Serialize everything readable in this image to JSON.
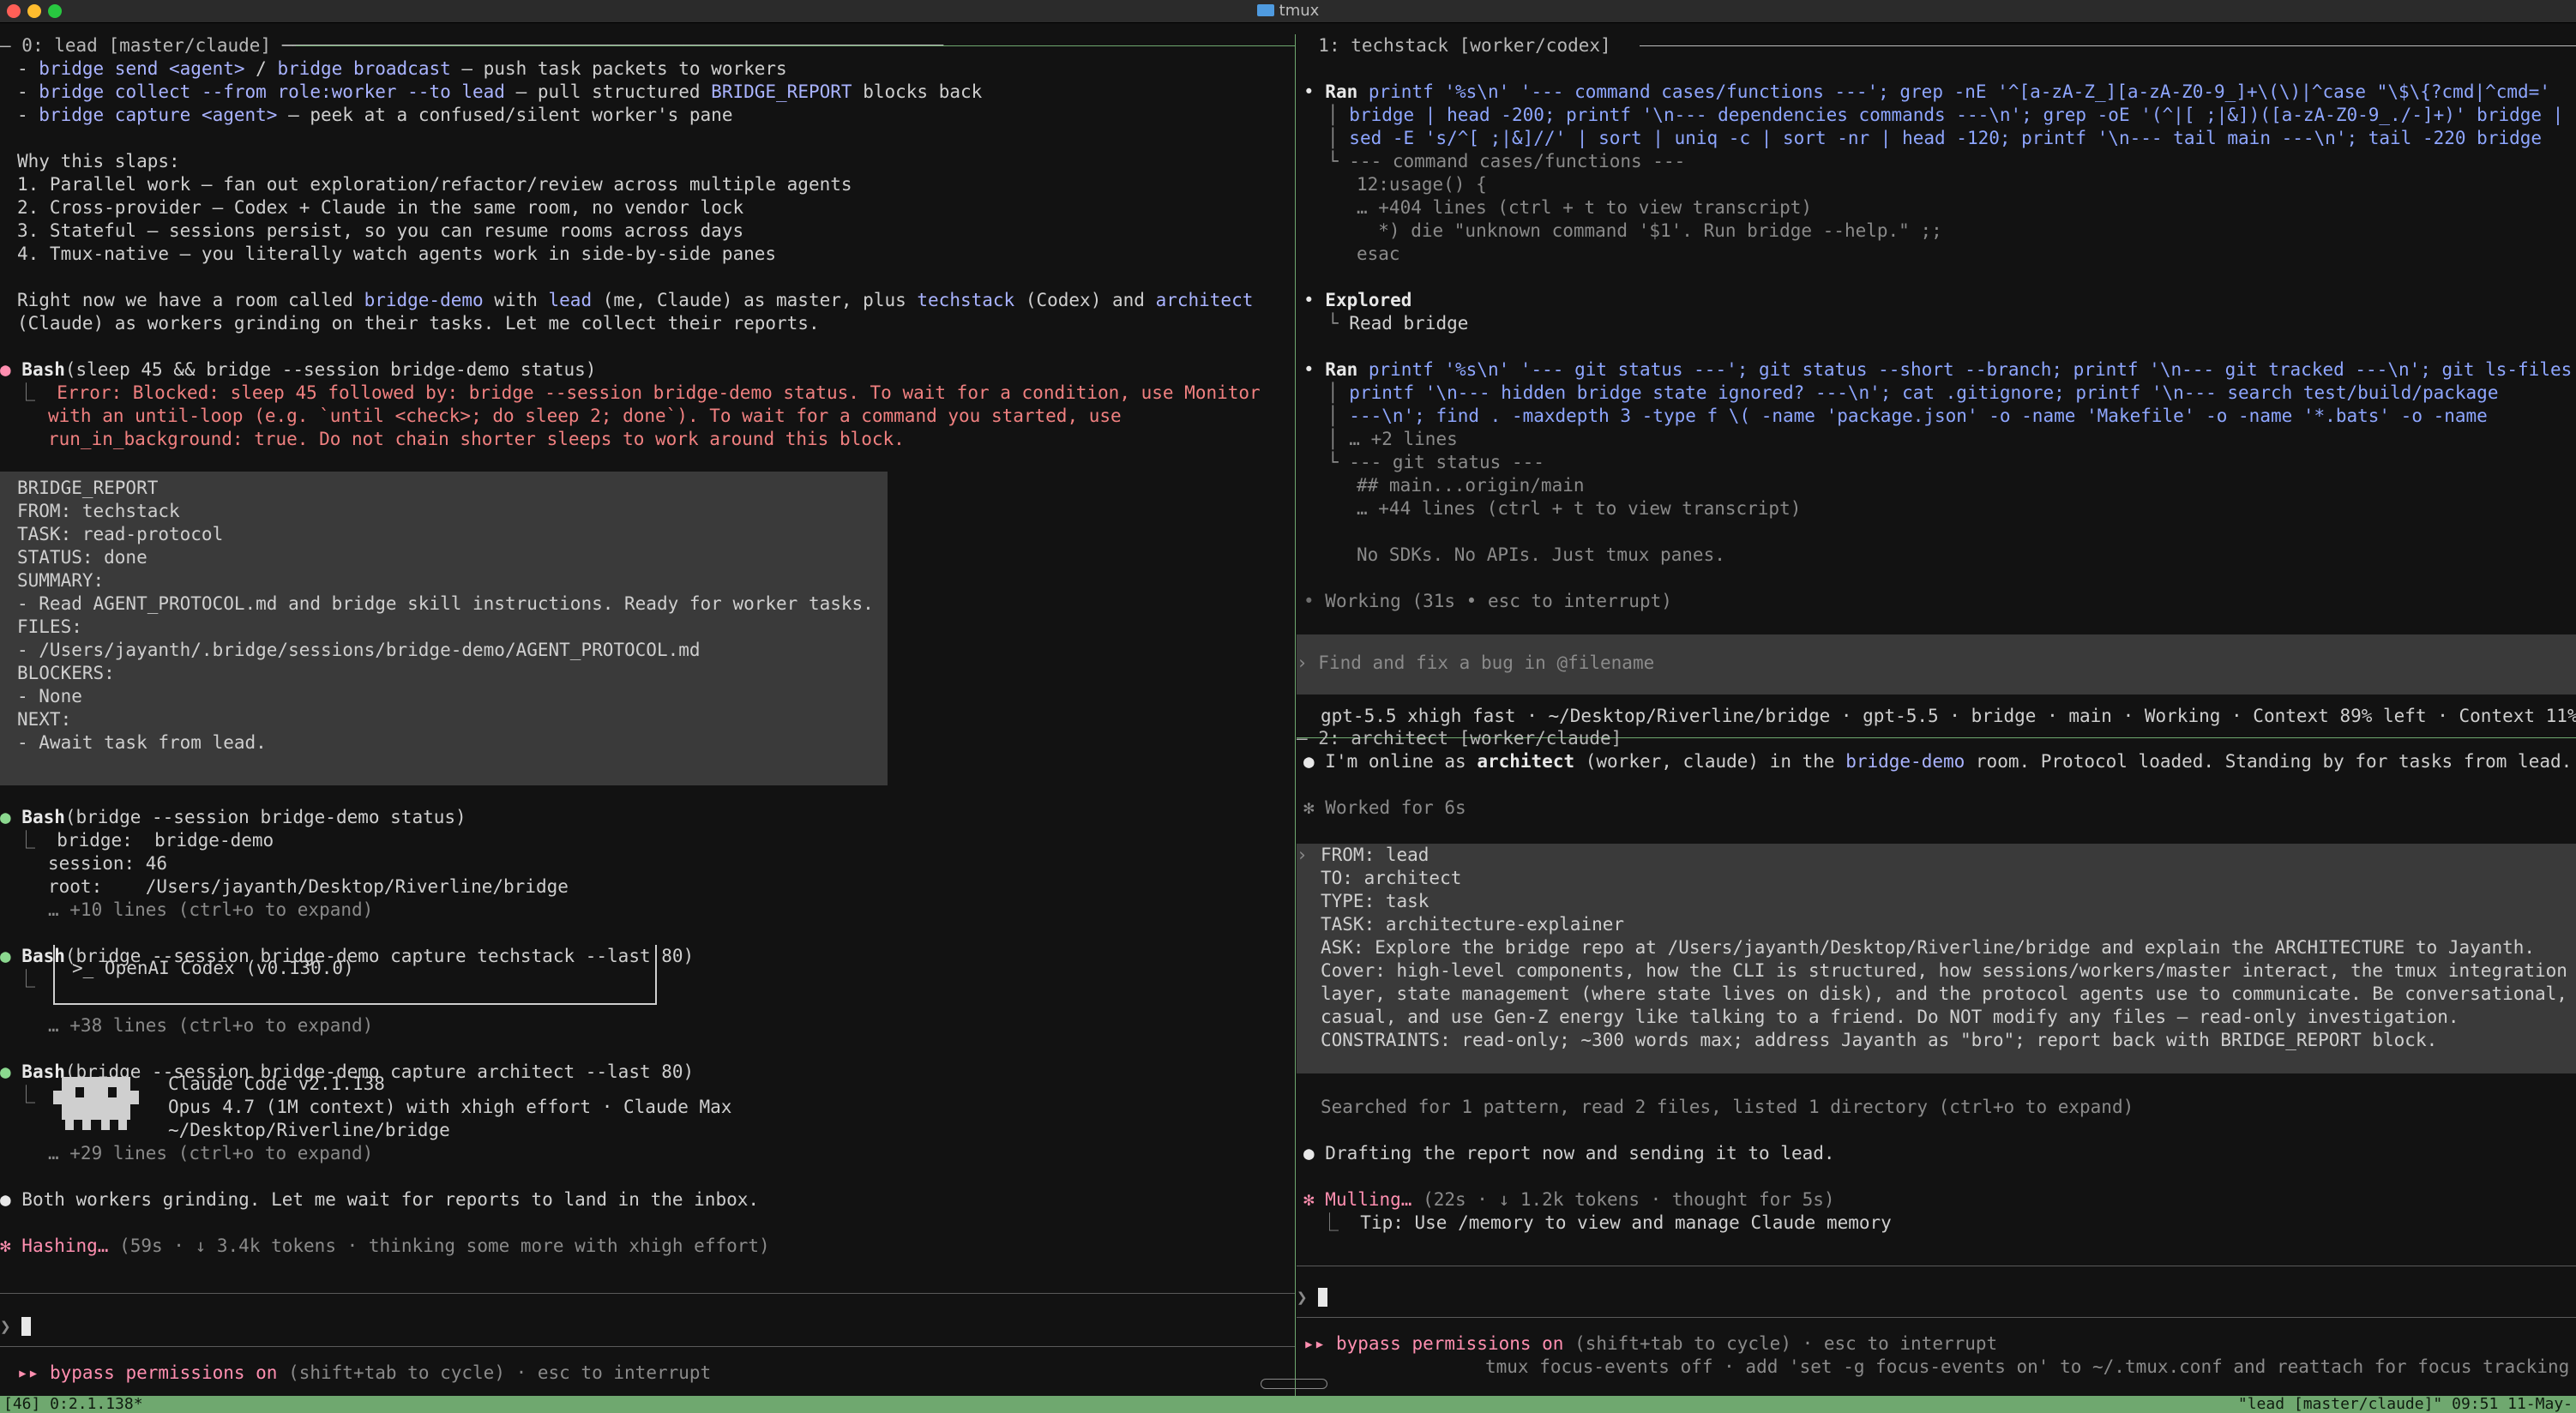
{
  "window": {
    "title": "tmux"
  },
  "left": {
    "header": "0: lead [master/claude]",
    "intro": [
      {
        "pre": "- ",
        "a": "bridge send <agent>",
        "b": " / ",
        "c": "bridge broadcast",
        "d": " — push task packets to workers"
      },
      {
        "pre": "- ",
        "a": "bridge collect --from role:worker --to lead",
        "b": " — pull structured ",
        "c": "BRIDGE_REPORT",
        "d": " blocks back"
      },
      {
        "pre": "- ",
        "a": "bridge capture <agent>",
        "b": " — peek at a confused/silent worker's pane",
        "c": "",
        "d": ""
      }
    ],
    "why_title": "Why this slaps:",
    "why": [
      "1. Parallel work — fan out exploration/refactor/review across multiple agents",
      "2. Cross-provider — Codex + Claude in the same room, no vendor lock",
      "3. Stateful — sessions persist, so you can resume rooms across days",
      "4. Tmux-native — you literally watch agents work in side-by-side panes"
    ],
    "room": {
      "p1": "Right now we have a room called ",
      "room": "bridge-demo",
      "p2": " with ",
      "lead": "lead",
      "p3": " (me, Claude) as master, plus ",
      "techstack": "techstack",
      "p4": " (Codex) and ",
      "architect": "architect",
      "line2": "(Claude) as workers grinding on their tasks. Let me collect their reports."
    },
    "bash1": {
      "name": "Bash",
      "cmd": "(sleep 45 && bridge --session bridge-demo status)",
      "err": [
        "Error: Blocked: sleep 45 followed by: bridge --session bridge-demo status. To wait for a condition, use Monitor",
        "with an until-loop (e.g. `until <check>; do sleep 2; done`). To wait for a command you started, use",
        "run_in_background: true. Do not chain shorter sleeps to work around this block."
      ]
    },
    "report": [
      "BRIDGE_REPORT",
      "FROM: techstack",
      "TASK: read-protocol",
      "STATUS: done",
      "SUMMARY:",
      "- Read AGENT_PROTOCOL.md and bridge skill instructions. Ready for worker tasks.",
      "FILES:",
      "- /Users/jayanth/.bridge/sessions/bridge-demo/AGENT_PROTOCOL.md",
      "BLOCKERS:",
      "- None",
      "NEXT:",
      "- Await task from lead."
    ],
    "bash2": {
      "name": "Bash",
      "cmd": "(bridge --session bridge-demo status)",
      "out": [
        "bridge:  bridge-demo",
        "session: 46",
        "root:    /Users/jayanth/Desktop/Riverline/bridge"
      ],
      "more": "… +10 lines (ctrl+o to expand)"
    },
    "bash3": {
      "name": "Bash",
      "cmd": "(bridge --session bridge-demo capture techstack --last 80)",
      "codex": ">_ OpenAI Codex (v0.130.0)",
      "more": "… +38 lines (ctrl+o to expand)"
    },
    "bash4": {
      "name": "Bash",
      "cmd": "(bridge --session bridge-demo capture architect --last 80)",
      "out": [
        "Claude Code v2.1.138",
        "Opus 4.7 (1M context) with xhigh effort · Claude Max",
        "~/Desktop/Riverline/bridge"
      ],
      "more": "… +29 lines (ctrl+o to expand)"
    },
    "msg": "Both workers grinding. Let me wait for reports to land in the inbox.",
    "hashing": {
      "a": "Hashing…",
      "b": " (59s · ↓ 3.4k tokens · thinking some more with xhigh effort)"
    },
    "bypass": {
      "a": "bypass permissions on",
      "b": " (shift+tab to cycle) · esc to interrupt"
    }
  },
  "right_top": {
    "header": "1: techstack [worker/codex]",
    "ran1": [
      "printf '%s\\n' '--- command cases/functions ---'; grep -nE '^[a-zA-Z_][a-zA-Z0-9_]+\\(\\)|^case \"\\$\\{?cmd|^cmd='",
      "bridge | head -200; printf '\\n--- dependencies commands ---\\n'; grep -oE '(^|[ ;|&])([a-zA-Z0-9_./-]+)' bridge |",
      "sed -E 's/^[ ;|&]//' | sort | uniq -c | sort -nr | head -120; printf '\\n--- tail main ---\\n'; tail -220 bridge"
    ],
    "out1": [
      "--- command cases/functions ---",
      "12:usage() {",
      "… +404 lines (ctrl + t to view transcript)",
      "  *) die \"unknown command '$1'. Run bridge --help.\" ;;",
      "esac"
    ],
    "explored": "Explored",
    "read": "Read bridge",
    "ran2": [
      "printf '%s\\n' '--- git status ---'; git status --short --branch; printf '\\n--- git tracked ---\\n'; git ls-files",
      "printf '\\n--- hidden bridge state ignored? ---\\n'; cat .gitignore; printf '\\n--- search test/build/package",
      "---\\n'; find . -maxdepth 3 -type f \\( -name 'package.json' -o -name 'Makefile' -o -name '*.bats' -o -name"
    ],
    "out2": [
      "… +2 lines",
      "--- git status ---",
      "## main...origin/main",
      "… +44 lines (ctrl + t to view transcript)"
    ],
    "nosdk": "No SDKs. No APIs. Just tmux panes.",
    "working": "Working (31s • esc to interrupt)",
    "prompt": "Find and fix a bug in @filename",
    "status": "gpt-5.5 xhigh fast · ~/Desktop/Riverline/bridge · gpt-5.5 · bridge · main · Working · Context 89% left · Context 11%"
  },
  "right_bottom": {
    "header": "2: architect [worker/claude]",
    "online": {
      "a": "I'm online as ",
      "b": "architect",
      "c": " (worker, claude) in the ",
      "d": "bridge-demo",
      "e": " room. Protocol loaded. Standing by for tasks from lead."
    },
    "worked": "Worked for 6s",
    "task": [
      "FROM: lead",
      "TO: architect",
      "TYPE: task",
      "TASK: architecture-explainer",
      "ASK: Explore the bridge repo at /Users/jayanth/Desktop/Riverline/bridge and explain the ARCHITECTURE to Jayanth.",
      "Cover: high-level components, how the CLI is structured, how sessions/workers/master interact, the tmux integration",
      "layer, state management (where state lives on disk), and the protocol agents use to communicate. Be conversational,",
      "casual, and use Gen-Z energy like talking to a friend. Do NOT modify any files — read-only investigation.",
      "CONSTRAINTS: read-only; ~300 words max; address Jayanth as \"bro\"; report back with BRIDGE_REPORT block."
    ],
    "searched": "Searched for 1 pattern, read 2 files, listed 1 directory (ctrl+o to expand)",
    "drafting": "Drafting the report now and sending it to lead.",
    "mulling": {
      "a": "Mulling…",
      "b": " (22s · ↓ 1.2k tokens · thought for 5s)"
    },
    "tip": "Tip: Use /memory to view and manage Claude memory",
    "bypass": {
      "a": "bypass permissions on",
      "b": " (shift+tab to cycle) · esc to interrupt"
    },
    "focus": "tmux focus-events off · add 'set -g focus-events on' to ~/.tmux.conf and reattach for focus tracking"
  },
  "statusbar": {
    "left": "[46] 0:2.1.138*",
    "right": "\"lead [master/claude]\" 09:51 11-May-"
  }
}
